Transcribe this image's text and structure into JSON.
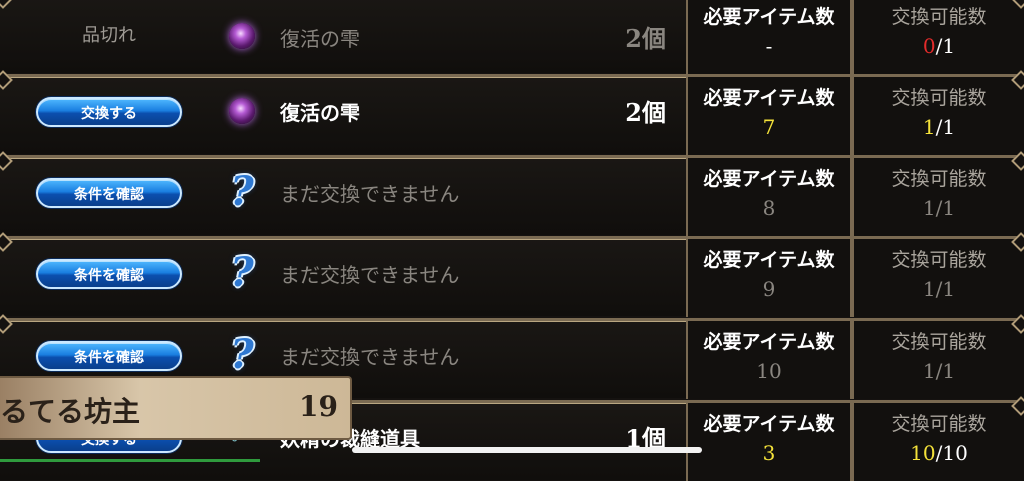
{
  "headers": {
    "required": "必要アイテム数",
    "exchangeable": "交換可能数"
  },
  "rows": [
    {
      "status": "品切れ",
      "icon": "purple-orb",
      "name": "復活の雫",
      "qty": "2個",
      "required": "-",
      "avail_now": "0",
      "avail_max": "/1"
    },
    {
      "button": "交換する",
      "icon": "purple-orb",
      "name": "復活の雫",
      "qty": "2個",
      "required": "7",
      "avail_now": "1",
      "avail_max": "/1"
    },
    {
      "button": "条件を確認",
      "icon": "question-mark",
      "name": "まだ交換できません",
      "required": "8",
      "avail": "1/1"
    },
    {
      "button": "条件を確認",
      "icon": "question-mark",
      "name": "まだ交換できません",
      "required": "9",
      "avail": "1/1"
    },
    {
      "button": "条件を確認",
      "icon": "question-mark",
      "name": "まだ交換できません",
      "required": "10",
      "avail": "1/1"
    },
    {
      "button": "交換する",
      "icon": "item",
      "name": "妖精の裁縫道具",
      "qty": "1個",
      "required": "3",
      "avail_now": "10",
      "avail_max": "/10"
    }
  ],
  "overlay": {
    "name": "るてる坊主",
    "count": "19"
  },
  "colors": {
    "accent_blue": "#1a7ee0",
    "yellow": "#f4e23a",
    "red": "#e22b2b"
  }
}
